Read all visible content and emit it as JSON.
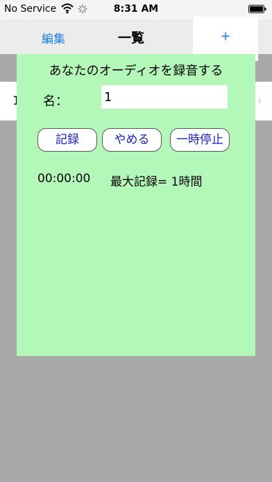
{
  "status": {
    "carrier": "No Service",
    "time": "8:31 AM"
  },
  "nav": {
    "edit_label": "編集",
    "title": "一覧",
    "add_label": "+"
  },
  "list": {
    "row_text": "1",
    "chevron": "›"
  },
  "dialog": {
    "title": "あなたのオーディオを録音する",
    "name_label": "名：",
    "name_value": "1",
    "buttons": {
      "record": "記録",
      "stop": "やめる",
      "pause": "一時停止"
    },
    "timer": "00:00:00",
    "max_record": "最大記録= 1時間"
  },
  "colors": {
    "dialog_bg": "#b3f7b9",
    "link": "#1a7ee6",
    "button_text": "#1b1bd1",
    "backdrop": "#a9a9a9"
  }
}
